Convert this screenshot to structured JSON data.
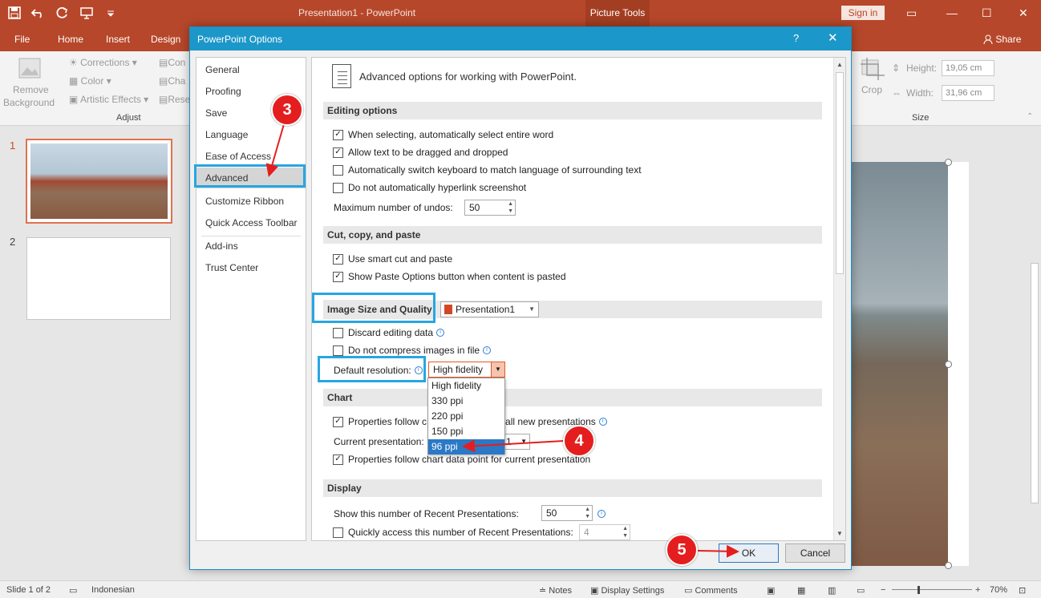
{
  "titlebar": {
    "app_title": "Presentation1  -  PowerPoint",
    "context_tab": "Picture Tools",
    "signin": "Sign in",
    "share": "Share",
    "icons": [
      "save-icon",
      "undo-icon",
      "redo-icon",
      "present-icon",
      "customize-icon",
      "ribbon-options-icon",
      "minimize-icon",
      "maximize-icon",
      "close-icon"
    ]
  },
  "tabs": [
    "File",
    "Home",
    "Insert",
    "Design"
  ],
  "ribbon": {
    "remove_bg_line1": "Remove",
    "remove_bg_line2": "Background",
    "corrections": "Corrections",
    "color": "Color",
    "artistic": "Artistic Effects",
    "con": "Con",
    "cha": "Cha",
    "rese": "Rese",
    "adjust_group": "Adjust",
    "crop": "Crop",
    "height_label": "Height:",
    "height_value": "19,05 cm",
    "width_label": "Width:",
    "width_value": "31,96 cm",
    "size_group": "Size"
  },
  "slides": [
    {
      "num": "1"
    },
    {
      "num": "2"
    }
  ],
  "status": {
    "slide": "Slide 1 of 2",
    "language": "Indonesian",
    "notes": "Notes",
    "display": "Display Settings",
    "comments": "Comments",
    "zoom": "70%"
  },
  "dialog": {
    "title": "PowerPoint Options",
    "help": "?",
    "close": "✕",
    "nav": [
      "General",
      "Proofing",
      "Save",
      "Language",
      "Ease of Access",
      "Advanced",
      "Customize Ribbon",
      "Quick Access Toolbar",
      "Add-ins",
      "Trust Center"
    ],
    "selected_nav": "Advanced",
    "header": "Advanced options for working with PowerPoint.",
    "editing": {
      "title": "Editing options",
      "opt1": "When selecting, automatically select entire word",
      "opt2": "Allow text to be dragged and dropped",
      "opt3": "Automatically switch keyboard to match language of surrounding text",
      "opt4": "Do not automatically hyperlink screenshot",
      "undos_label": "Maximum number of undos:",
      "undos_value": "50"
    },
    "cut": {
      "title": "Cut, copy, and paste",
      "opt1": "Use smart cut and paste",
      "opt2": "Show Paste Options button when content is pasted"
    },
    "image": {
      "title": "Image Size and Quality",
      "file": "Presentation1",
      "opt1": "Discard editing data",
      "opt2": "Do not compress images in file",
      "res_label": "Default resolution:",
      "res_value": "High fidelity",
      "options": [
        "High fidelity",
        "330 ppi",
        "220 ppi",
        "150 ppi",
        "96 ppi"
      ],
      "selected": "96 ppi"
    },
    "chart": {
      "title": "Chart",
      "opt1a": "Properties follow c",
      "opt1b": "all new presentations",
      "current_label": "Current presentation:",
      "current_value": "1",
      "opt2": "Properties follow chart data point for current presentation"
    },
    "display": {
      "title": "Display",
      "recent_label": "Show this number of Recent Presentations:",
      "recent_value": "50",
      "quick_label": "Quickly access this number of Recent Presentations:",
      "quick_value": "4"
    },
    "ok": "OK",
    "cancel": "Cancel"
  },
  "annotations": {
    "badge3": "3",
    "badge4": "4",
    "badge5": "5",
    "color": "#e41e1e",
    "highlight": "#27a6e2"
  }
}
